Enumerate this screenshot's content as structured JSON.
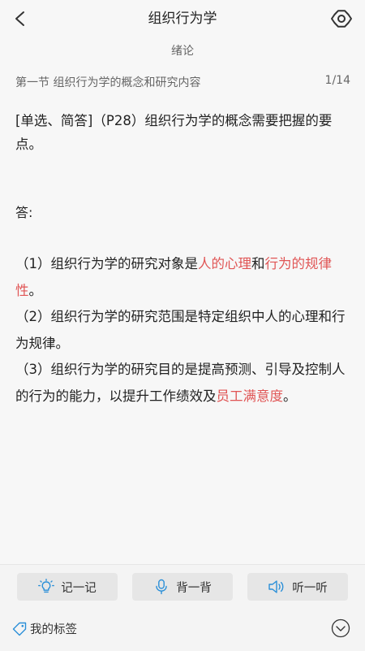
{
  "header": {
    "title": "组织行为学",
    "back_icon": "chevron-left-icon",
    "settings_icon": "gear-icon"
  },
  "chapter": "绪论",
  "section": {
    "name": "第一节 组织行为学的概念和研究内容",
    "page": "1/14"
  },
  "question": {
    "text": "[单选、简答]（P28）组织行为学的概念需要把握的要点。"
  },
  "answer": {
    "label": "答:",
    "p1_a": "（1）组织行为学的研究对象是",
    "p1_hl1": "人的心理",
    "p1_b": "和",
    "p1_hl2": "行为的规律性",
    "p1_c": "。",
    "p2": "（2）组织行为学的研究范围是特定组织中人的心理和行为规律。",
    "p3_a": "（3）组织行为学的研究目的是提高预测、引导及控制人的行为的能力，以提升工作绩效及",
    "p3_hl": "员工满意度",
    "p3_b": "。"
  },
  "actions": {
    "memo_label": "记一记",
    "recite_label": "背一背",
    "listen_label": "听一听"
  },
  "tags_label": "我的标签",
  "colors": {
    "highlight": "#e05555",
    "icon_blue": "#2a8fd8"
  }
}
